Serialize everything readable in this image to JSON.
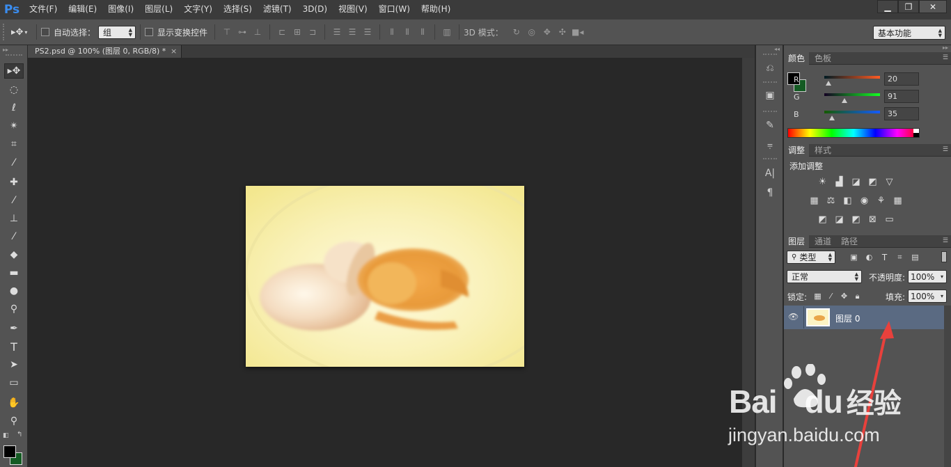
{
  "menubar": {
    "logo": "Ps",
    "items": [
      "文件(F)",
      "编辑(E)",
      "图像(I)",
      "图层(L)",
      "文字(Y)",
      "选择(S)",
      "滤镜(T)",
      "3D(D)",
      "视图(V)",
      "窗口(W)",
      "帮助(H)"
    ],
    "window_controls": {
      "minimize": "▁",
      "restore": "❐",
      "close": "✕"
    }
  },
  "options": {
    "auto_select_label": "自动选择：",
    "auto_select_value": "组",
    "show_transform_label": "显示变换控件",
    "mode_3d_label": "3D 模式：",
    "workspace": "基本功能"
  },
  "document": {
    "tab_title": "PS2.psd @ 100% (图层 0, RGB/8) *",
    "close": "×"
  },
  "color_panel": {
    "tabs": [
      "颜色",
      "色板"
    ],
    "r_label": "R",
    "r_value": "20",
    "r_fraction": 0.078,
    "g_label": "G",
    "g_value": "91",
    "g_fraction": 0.357,
    "b_label": "B",
    "b_value": "35",
    "b_fraction": 0.137,
    "foreground": "#000000",
    "background": "#145b23"
  },
  "adjust_panel": {
    "tabs": [
      "调整",
      "样式"
    ],
    "title": "添加调整"
  },
  "layers_panel": {
    "tabs": [
      "图层",
      "通道",
      "路径"
    ],
    "filter_label": "类型",
    "blend_mode": "正常",
    "opacity_label": "不透明度:",
    "opacity_value": "100%",
    "lock_label": "锁定:",
    "fill_label": "填充:",
    "fill_value": "100%",
    "layers": [
      {
        "name": "图层 0",
        "visible": true
      }
    ]
  },
  "watermark": {
    "brand": "Bai",
    "brand2": "du",
    "suffix": "经验",
    "url": "jingyan.baidu.com"
  },
  "colors": {
    "accent_arrow": "#e8413c",
    "layer_selected": "#5a6a82"
  }
}
